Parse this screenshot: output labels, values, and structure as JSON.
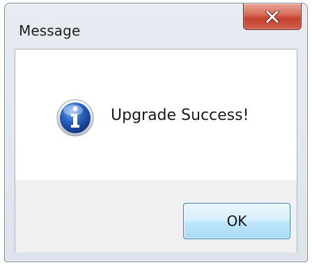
{
  "dialog": {
    "title": "Message",
    "message": "Upgrade Success!",
    "ok_label": "OK",
    "icon": "info-icon",
    "close_icon": "close-icon"
  },
  "colors": {
    "close_button": "#c4422f",
    "ok_border": "#3c7fb1",
    "info_icon_blue": "#1d4fa8"
  }
}
